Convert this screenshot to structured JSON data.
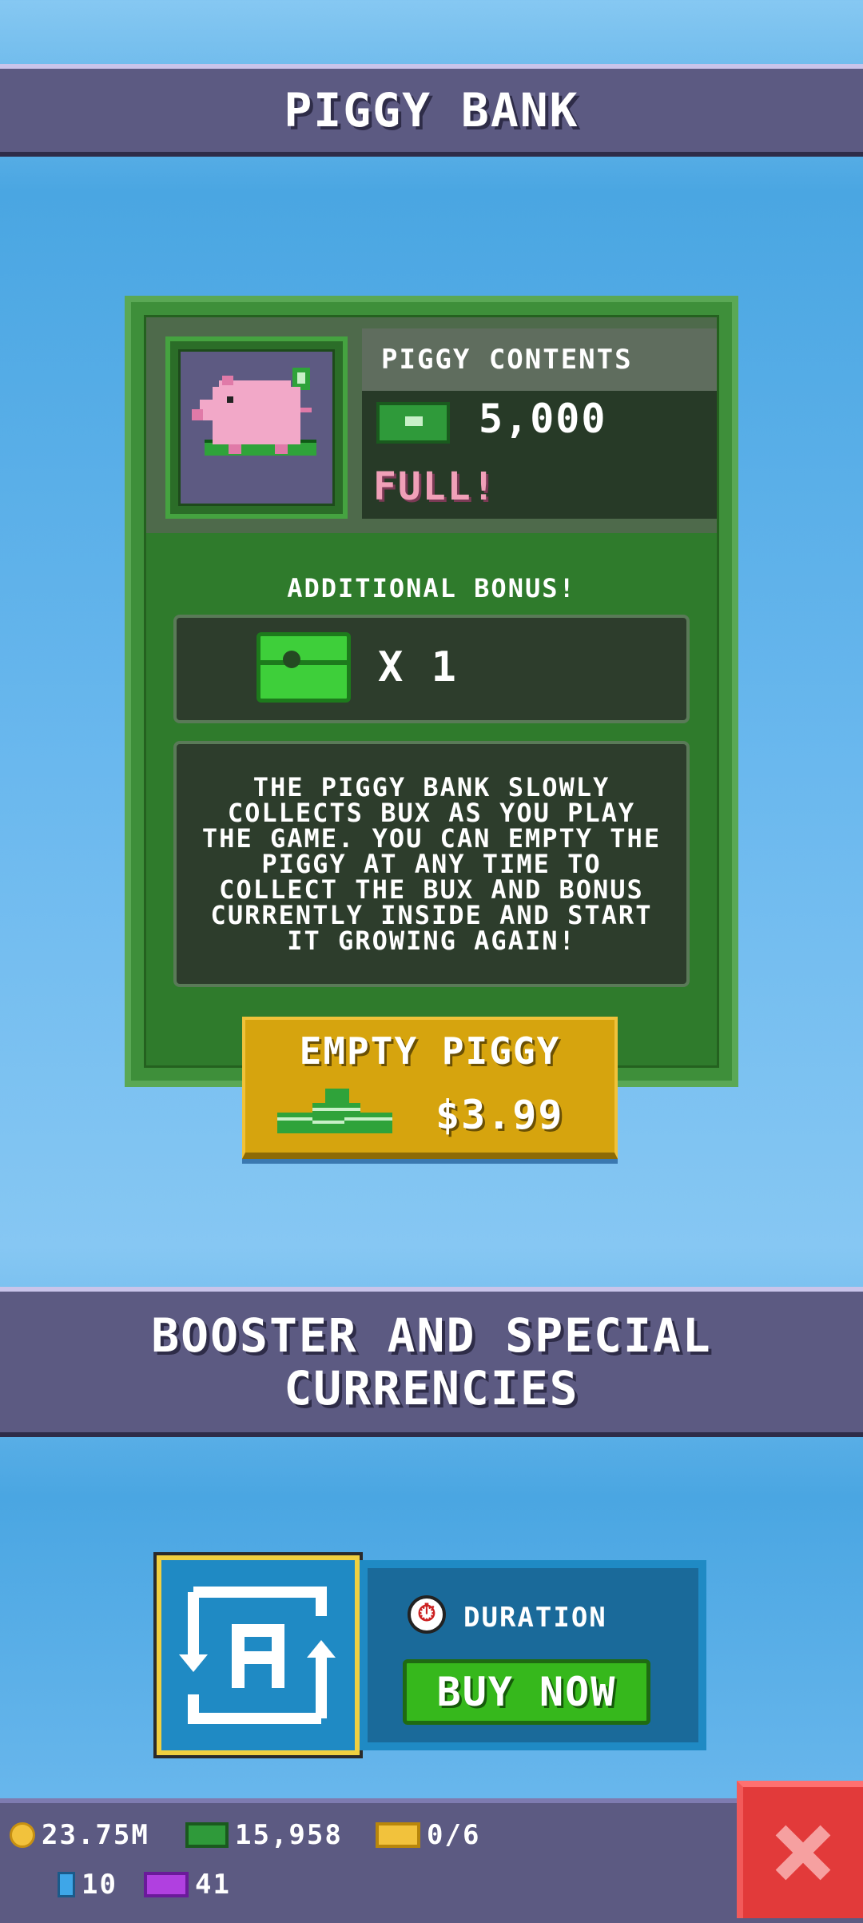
{
  "piggy_bank": {
    "header": "PIGGY BANK",
    "contents_title": "PIGGY CONTENTS",
    "contents_amount": "5,000",
    "status": "FULL!",
    "bonus_title": "ADDITIONAL BONUS!",
    "bonus_count": "X 1",
    "description": "THE PIGGY BANK SLOWLY COLLECTS BUX AS YOU PLAY THE GAME. YOU CAN EMPTY THE PIGGY AT ANY TIME TO COLLECT THE BUX AND BONUS CURRENTLY INSIDE AND START IT GROWING AGAIN!",
    "button_label": "EMPTY PIGGY",
    "button_price": "$3.99"
  },
  "booster": {
    "header": "BOOSTER AND SPECIAL CURRENCIES",
    "duration_label": "DURATION",
    "buy_label": "BUY NOW"
  },
  "currencies": {
    "coins": "23.75M",
    "bux": "15,958",
    "tickets": "0/6",
    "gems": "10",
    "purple": "41"
  },
  "colors": {
    "panel_green": "#3e8f3a",
    "button_gold": "#d6a40e",
    "banner": "#5c5a82",
    "close_red": "#e23a3a"
  },
  "icons": [
    "pig-icon",
    "bux-icon",
    "chest-icon",
    "cash-stack-icon",
    "auto-icon",
    "clock-icon",
    "coin-icon",
    "ticket-icon",
    "gem-icon",
    "close-icon"
  ]
}
